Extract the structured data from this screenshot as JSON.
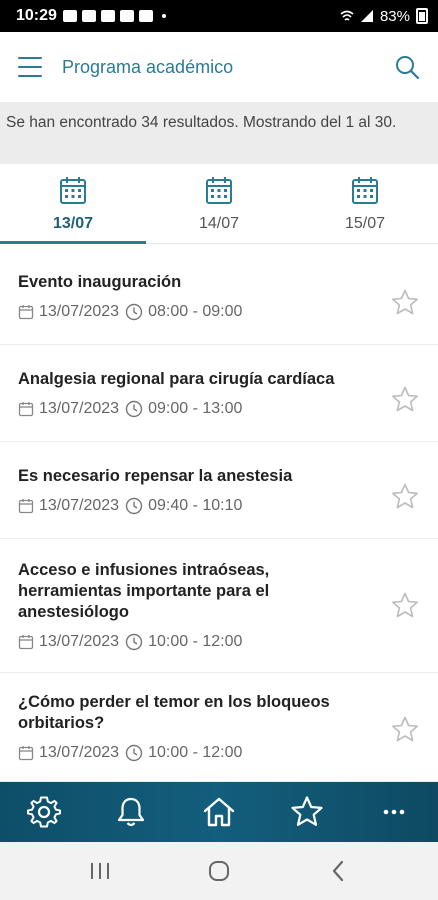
{
  "status_bar": {
    "time": "10:29",
    "battery": "83%"
  },
  "app_bar": {
    "title": "Programa académico"
  },
  "results": {
    "text": "Se han encontrado 34 resultados. Mostrando del 1 al 30."
  },
  "tabs": [
    {
      "label": "13/07",
      "active": true
    },
    {
      "label": "14/07",
      "active": false
    },
    {
      "label": "15/07",
      "active": false
    }
  ],
  "events": [
    {
      "title": "Evento inauguración",
      "date": "13/07/2023",
      "time": "08:00 - 09:00"
    },
    {
      "title": "Analgesia regional para cirugía cardíaca",
      "date": "13/07/2023",
      "time": "09:00 - 13:00"
    },
    {
      "title": "Es necesario repensar la anestesia",
      "date": "13/07/2023",
      "time": "09:40 - 10:10"
    },
    {
      "title": "Acceso e infusiones intraóseas, herramientas importante para el anestesiólogo",
      "date": "13/07/2023",
      "time": "10:00 - 12:00"
    },
    {
      "title": "¿Cómo perder el temor en los bloqueos orbitarios?",
      "date": "13/07/2023",
      "time": "10:00 - 12:00"
    }
  ],
  "bottom_nav": [
    "settings-icon",
    "bell-icon",
    "home-icon",
    "star-icon",
    "more-icon"
  ],
  "colors": {
    "accent": "#2a7b96",
    "nav_bg": "#135e7d"
  }
}
